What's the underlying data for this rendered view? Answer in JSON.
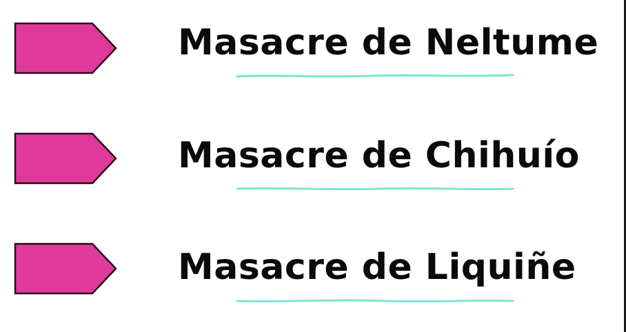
{
  "colors": {
    "arrow_fill": "#e0399c",
    "arrow_stroke": "#2a0a1a",
    "underline": "#7fe3d3",
    "text": "#0a0a0a"
  },
  "items": [
    {
      "label": "Masacre de Neltume",
      "icon": "pink-arrow-icon"
    },
    {
      "label": "Masacre de Chihuío",
      "icon": "pink-arrow-icon"
    },
    {
      "label": "Masacre de Liquiñe",
      "icon": "pink-arrow-icon"
    }
  ]
}
